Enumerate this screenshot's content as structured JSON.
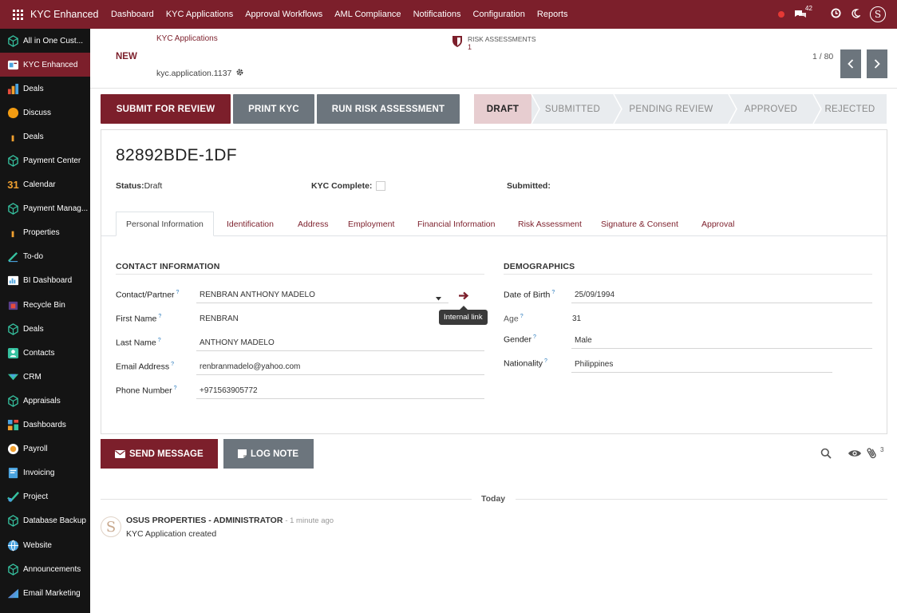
{
  "topbar": {
    "brand": "KYC Enhanced",
    "menu": [
      "Dashboard",
      "KYC Applications",
      "Approval Workflows",
      "AML Compliance",
      "Notifications",
      "Configuration",
      "Reports"
    ],
    "chat_count": "42",
    "avatar_letter": "S"
  },
  "sidebar": {
    "items": [
      {
        "label": "All in One Cust...",
        "icon": "box-icon",
        "color": "#36c2a0"
      },
      {
        "label": "KYC Enhanced",
        "icon": "kyc-icon",
        "color": "#4aa3df",
        "active": true
      },
      {
        "label": "Deals",
        "icon": "bar-chart-icon",
        "color": "#f0a030"
      },
      {
        "label": "Discuss",
        "icon": "chat-bubble-icon",
        "color": "#f39c12"
      },
      {
        "label": "Deals",
        "icon": "small-bar-icon",
        "color": "#f0a030"
      },
      {
        "label": "Payment Center",
        "icon": "box-icon",
        "color": "#36c2a0"
      },
      {
        "label": "Calendar",
        "icon": "calendar-icon",
        "color": "#f0a030"
      },
      {
        "label": "Payment Manag...",
        "icon": "box-icon",
        "color": "#36c2a0"
      },
      {
        "label": "Properties",
        "icon": "small-bar-icon",
        "color": "#f0a030"
      },
      {
        "label": "To-do",
        "icon": "pen-icon",
        "color": "#36c2a0"
      },
      {
        "label": "BI Dashboard",
        "icon": "bi-icon",
        "color": "#4aa3df"
      },
      {
        "label": "Recycle Bin",
        "icon": "recycle-icon",
        "color": "#e74c3c"
      },
      {
        "label": "Deals",
        "icon": "box-icon",
        "color": "#36c2a0"
      },
      {
        "label": "Contacts",
        "icon": "contacts-icon",
        "color": "#36c2a0"
      },
      {
        "label": "CRM",
        "icon": "crm-icon",
        "color": "#36c2a0"
      },
      {
        "label": "Appraisals",
        "icon": "box-icon",
        "color": "#36c2a0"
      },
      {
        "label": "Dashboards",
        "icon": "dashboards-icon",
        "color": "#e74c3c"
      },
      {
        "label": "Payroll",
        "icon": "payroll-icon",
        "color": "#f0a030"
      },
      {
        "label": "Invoicing",
        "icon": "invoice-icon",
        "color": "#4aa3df"
      },
      {
        "label": "Project",
        "icon": "project-icon",
        "color": "#36c2a0"
      },
      {
        "label": "Database Backup",
        "icon": "box-icon",
        "color": "#36c2a0"
      },
      {
        "label": "Website",
        "icon": "globe-icon",
        "color": "#4aa3df"
      },
      {
        "label": "Announcements",
        "icon": "box-icon",
        "color": "#36c2a0"
      },
      {
        "label": "Email Marketing",
        "icon": "email-marketing-icon",
        "color": "#4aa3df"
      }
    ]
  },
  "control": {
    "breadcrumb": "KYC Applications",
    "new_label": "NEW",
    "record_ref": "kyc.application.1137",
    "risk_label": "RISK ASSESSMENTS",
    "risk_count": "1",
    "pager": "1 / 80"
  },
  "actions": {
    "submit": "SUBMIT FOR REVIEW",
    "print": "PRINT KYC",
    "risk": "RUN RISK ASSESSMENT"
  },
  "stages": [
    "DRAFT",
    "SUBMITTED",
    "PENDING REVIEW",
    "APPROVED",
    "REJECTED"
  ],
  "active_stage": "DRAFT",
  "record": {
    "name": "82892BDE-1DF",
    "status_label": "Status:",
    "status_value": "Draft",
    "kyc_complete_label": "KYC Complete:",
    "submitted_label": "Submitted:"
  },
  "tabs": [
    "Personal Information",
    "Identification",
    "Address",
    "Employment",
    "Financial Information",
    "Risk Assessment",
    "Signature & Consent",
    "Approval"
  ],
  "contact": {
    "title": "CONTACT INFORMATION",
    "fields": [
      {
        "label": "Contact/Partner",
        "value": "RENBRAN ANTHONY MADELO"
      },
      {
        "label": "First Name",
        "value": "RENBRAN"
      },
      {
        "label": "Last Name",
        "value": "ANTHONY MADELO"
      },
      {
        "label": "Email Address",
        "value": "renbranmadelo@yahoo.com"
      },
      {
        "label": "Phone Number",
        "value": "+971563905772"
      }
    ],
    "tooltip": "Internal link"
  },
  "demographics": {
    "title": "DEMOGRAPHICS",
    "fields": [
      {
        "label": "Date of Birth",
        "value": "25/09/1994"
      },
      {
        "label": "Age",
        "value": "31"
      },
      {
        "label": "Gender",
        "value": "Male"
      },
      {
        "label": "Nationality",
        "value": "Philippines"
      }
    ]
  },
  "chatter": {
    "send": "SEND MESSAGE",
    "log": "LOG NOTE",
    "attachments": "3",
    "today": "Today",
    "author": "OSUS PROPERTIES - ADMINISTRATOR",
    "time": "- 1 minute ago",
    "body": "KYC Application created"
  },
  "colors": {
    "brand": "#7c1f2b",
    "secondary": "#6c757d"
  }
}
